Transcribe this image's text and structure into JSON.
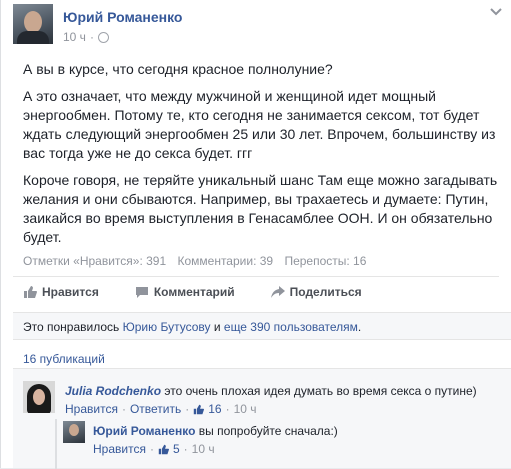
{
  "post": {
    "author": "Юрий Романенко",
    "time": "10 ч",
    "paragraphs": [
      "А вы в курсе, что сегодня красное полнолуние?",
      "А это означает, что между мужчиной и женщиной идет мощный энергообмен. Потому те, кто сегодня не занимается сексом, тот будет ждать следующий энергообмен 25 или 30 лет. Впрочем, большинству из вас тогда уже не до секса будет. ггг",
      "Короче говоря, не теряйте уникальный шанс Там еще можно загадывать желания и они сбываются. Например, вы трахаетесь и думаете: Путин, заикайся во время выступления в Генасамблее ООН. И он обязательно будет."
    ],
    "stats": {
      "likes": "Отметки «Нравится»: 391",
      "comments": "Комментарии: 39",
      "shares": "Перепосты: 16"
    }
  },
  "actions": {
    "like": "Нравится",
    "comment": "Комментарий",
    "share": "Поделиться"
  },
  "likes_box": {
    "prefix": "Это понравилось",
    "user": "Юрию Бутусову",
    "and": "и",
    "others": "еще 390 пользователям",
    "suffix": "."
  },
  "shares_link": "16 публикаций",
  "comments": [
    {
      "author": "Julia Rodchenko",
      "text": "это очень плохая идея думать во время секса о путине)",
      "like": "Нравится",
      "reply": "Ответить",
      "likes": "16",
      "time": "10 ч"
    },
    {
      "author": "Юрий Романенко",
      "text": "вы попробуйте сначала:)",
      "like": "Нравится",
      "likes": "5",
      "time": "10 ч"
    }
  ],
  "colors": {
    "link": "#365899",
    "muted": "#90949c"
  },
  "icons": [
    "globe-icon",
    "chevron-down-icon",
    "thumbs-up-icon",
    "comment-icon",
    "share-icon"
  ]
}
